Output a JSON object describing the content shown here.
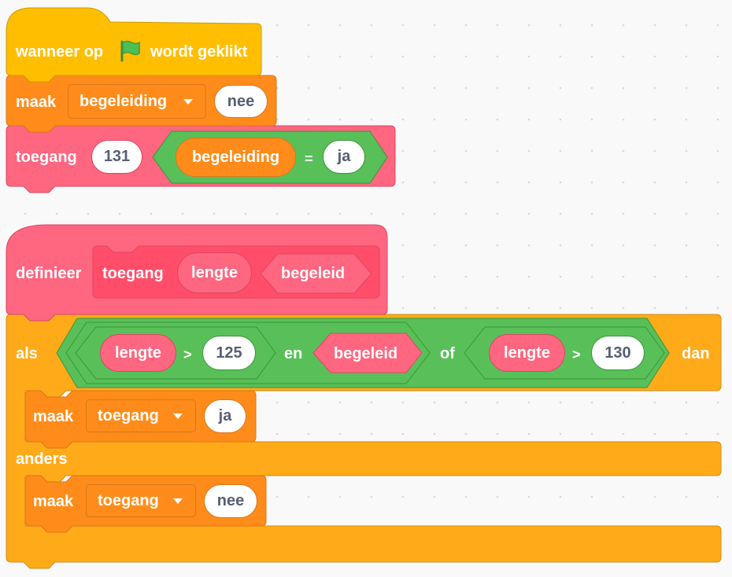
{
  "script1": {
    "hat": {
      "prefix": "wanneer op",
      "suffix": "wordt geklikt",
      "flag_icon": "green-flag-icon"
    },
    "set_block": {
      "label": "maak",
      "variable": "begeleiding",
      "value": "nee"
    },
    "call_block": {
      "label": "toegang",
      "arg1": "131",
      "compare": {
        "left_reporter": "begeleiding",
        "operator": "=",
        "right_value": "ja"
      }
    }
  },
  "script2": {
    "define_block": {
      "label": "definieer",
      "proto_name": "toegang",
      "param_number": "lengte",
      "param_boolean": "begeleid"
    },
    "if_block": {
      "label_if": "als",
      "label_then": "dan",
      "label_else": "anders",
      "condition": {
        "left": {
          "reporter": "lengte",
          "operator": ">",
          "value": "125"
        },
        "and_label": "en",
        "middle_boolean": "begeleid",
        "or_label": "of",
        "right": {
          "reporter": "lengte",
          "operator": ">",
          "value": "130"
        }
      },
      "then_set": {
        "label": "maak",
        "variable": "toegang",
        "value": "ja"
      },
      "else_set": {
        "label": "maak",
        "variable": "toegang",
        "value": "nee"
      }
    }
  },
  "colors": {
    "events": "#ffbf00",
    "variables": "#ff8c1a",
    "custom": "#ff6680",
    "operators": "#59c059",
    "control": "#ffab19",
    "text_on_block": "#ffffff",
    "text_in_field": "#575e75"
  }
}
